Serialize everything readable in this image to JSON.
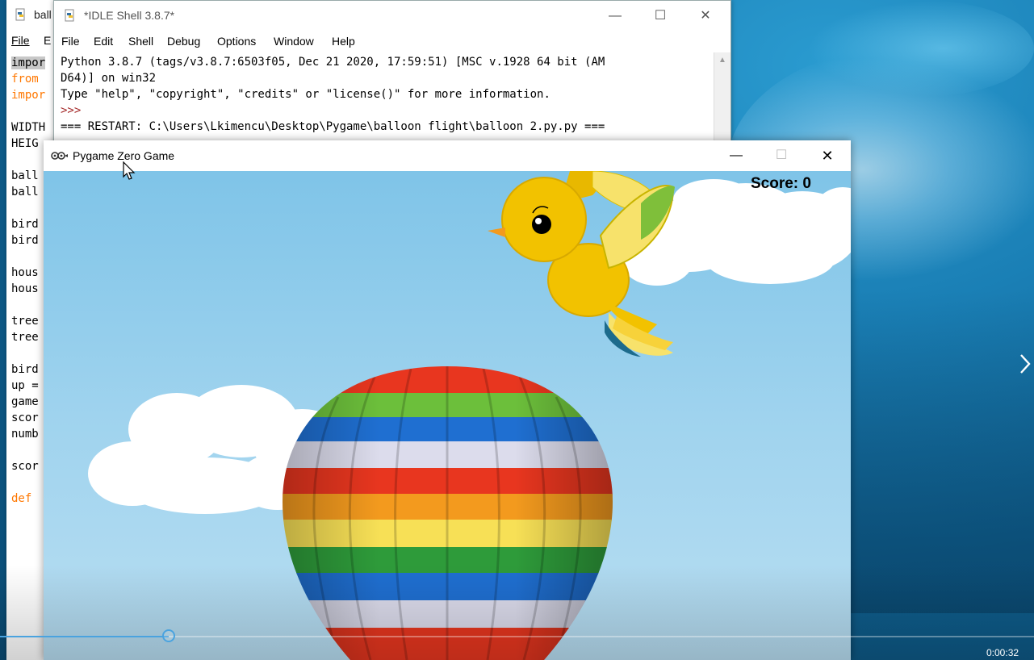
{
  "editor": {
    "title": "ball",
    "menu": [
      "File",
      "E"
    ],
    "code_lines": [
      {
        "text": "impor",
        "style": "sel"
      },
      {
        "text": "from ",
        "style": "kw"
      },
      {
        "text": "impor",
        "style": "kw"
      },
      {
        "text": "",
        "style": "plain"
      },
      {
        "text": "WIDTH",
        "style": "plain"
      },
      {
        "text": "HEIG",
        "style": "plain"
      },
      {
        "text": "",
        "style": "plain"
      },
      {
        "text": "ball",
        "style": "plain"
      },
      {
        "text": "ball",
        "style": "plain"
      },
      {
        "text": "",
        "style": "plain"
      },
      {
        "text": "bird",
        "style": "plain"
      },
      {
        "text": "bird",
        "style": "plain"
      },
      {
        "text": "",
        "style": "plain"
      },
      {
        "text": "hous",
        "style": "plain"
      },
      {
        "text": "hous",
        "style": "plain"
      },
      {
        "text": "",
        "style": "plain"
      },
      {
        "text": "tree",
        "style": "plain"
      },
      {
        "text": "tree",
        "style": "plain"
      },
      {
        "text": "",
        "style": "plain"
      },
      {
        "text": "bird",
        "style": "plain"
      },
      {
        "text": "up =",
        "style": "plain"
      },
      {
        "text": "game",
        "style": "plain"
      },
      {
        "text": "scor",
        "style": "plain"
      },
      {
        "text": "numb",
        "style": "plain"
      },
      {
        "text": "",
        "style": "plain"
      },
      {
        "text": "scor",
        "style": "plain"
      },
      {
        "text": "",
        "style": "plain"
      },
      {
        "text": "def ",
        "style": "kw"
      }
    ]
  },
  "shell": {
    "title": "*IDLE Shell 3.8.7*",
    "menu": {
      "file": "File",
      "edit": "Edit",
      "shell": "Shell",
      "debug": "Debug",
      "options": "Options",
      "window": "Window",
      "help": "Help"
    },
    "lines": {
      "l1": "Python 3.8.7 (tags/v3.8.7:6503f05, Dec 21 2020, 17:59:51) [MSC v.1928 64 bit (AM",
      "l2": "D64)] on win32",
      "l3": "Type \"help\", \"copyright\", \"credits\" or \"license()\" for more information.",
      "l4": ">>> ",
      "l5": "=== RESTART: C:\\Users\\Lkimencu\\Desktop\\Pygame\\balloon flight\\balloon 2.py.py ==="
    }
  },
  "game": {
    "title": "Pygame Zero Game",
    "score": "Score: 0"
  },
  "video": {
    "time": "0:00:32",
    "progress": 0.163
  },
  "colors": {
    "sky": "#9fd3ee",
    "keyword": "#ff7700",
    "prompt": "#a52a2a",
    "seek": "#4aa3df"
  }
}
